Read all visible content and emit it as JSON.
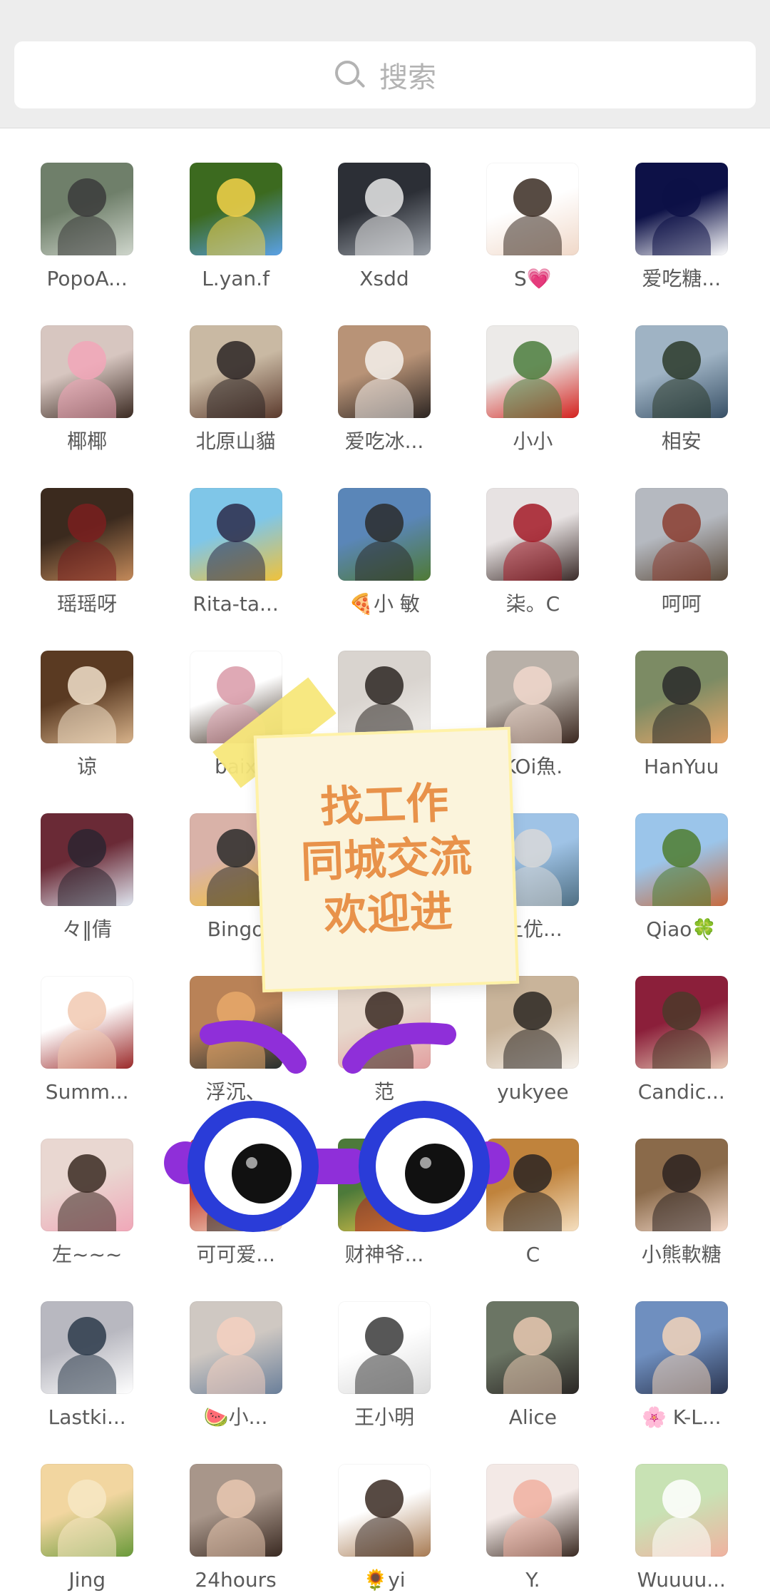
{
  "search": {
    "placeholder": "搜索"
  },
  "members": [
    {
      "name": "PopoA...",
      "colors": [
        "#6f7f6a",
        "#cfd6cc",
        "#3b3b3b"
      ]
    },
    {
      "name": "L.yan.f",
      "colors": [
        "#3c6a1f",
        "#5aa1e6",
        "#f4d24a"
      ]
    },
    {
      "name": "Xsdd",
      "colors": [
        "#2c2f36",
        "#9aa0a8",
        "#e8e8e8"
      ]
    },
    {
      "name": "S💗",
      "colors": [
        "#ffffff",
        "#f0d8c8",
        "#3a2b22"
      ]
    },
    {
      "name": "爱吃糖...",
      "colors": [
        "#0d1147",
        "#ffffff",
        "#0d1147"
      ]
    },
    {
      "name": "椰椰",
      "colors": [
        "#d7c6c0",
        "#3b2a22",
        "#f2a6b8"
      ]
    },
    {
      "name": "北原山貓",
      "colors": [
        "#c9b9a3",
        "#5b3a2d",
        "#2c2424"
      ]
    },
    {
      "name": "爱吃冰...",
      "colors": [
        "#b89377",
        "#2c2522",
        "#f5f1ec"
      ]
    },
    {
      "name": "小小",
      "colors": [
        "#eceae8",
        "#d4221e",
        "#4b7d3c"
      ]
    },
    {
      "name": "相安",
      "colors": [
        "#9fb3c4",
        "#385066",
        "#2c3a2a"
      ]
    },
    {
      "name": "瑶瑶呀",
      "colors": [
        "#3b2a1e",
        "#c48a5a",
        "#7a1f1f"
      ]
    },
    {
      "name": "Rita-ta...",
      "colors": [
        "#7fc6e8",
        "#f0c23a",
        "#2c2a4a"
      ]
    },
    {
      "name": "🍕小 敏",
      "colors": [
        "#5a86b8",
        "#4f7a35",
        "#2b2b2b"
      ]
    },
    {
      "name": "柒。C",
      "colors": [
        "#e7e2e2",
        "#3a2a28",
        "#a31a27"
      ]
    },
    {
      "name": "呵呵",
      "colors": [
        "#b5b9c0",
        "#5b4a3a",
        "#8b3d30"
      ]
    },
    {
      "name": "谅",
      "colors": [
        "#5a3a22",
        "#d7b28a",
        "#f2e2cb"
      ]
    },
    {
      "name": "baix",
      "colors": [
        "#ffffff",
        "#3a2a1e",
        "#d99aa8"
      ]
    },
    {
      "name": "",
      "colors": [
        "#d9d4cf",
        "#f3f1ee",
        "#2b2622"
      ]
    },
    {
      "name": "KOi魚.",
      "colors": [
        "#b8b0a8",
        "#3b2820",
        "#f1d8cc"
      ]
    },
    {
      "name": "HanYuu",
      "colors": [
        "#7c8b64",
        "#e8a86a",
        "#2a2a2a"
      ]
    },
    {
      "name": "々‖倩",
      "colors": [
        "#6a2a36",
        "#e0e6f0",
        "#2b2430"
      ]
    },
    {
      "name": "Bingo",
      "colors": [
        "#d9b2a8",
        "#f3c233",
        "#2a2a2a"
      ]
    },
    {
      "name": "",
      "colors": [
        "#ffffff",
        "#ffffff",
        "#ffffff"
      ]
    },
    {
      "name": "上优...",
      "colors": [
        "#9fc3e6",
        "#4f6f83",
        "#d8d8d8"
      ]
    },
    {
      "name": "Qiao🍀",
      "colors": [
        "#9bc5ea",
        "#c76a3e",
        "#4f7d2f"
      ]
    },
    {
      "name": "Summ...",
      "colors": [
        "#ffffff",
        "#9b2a2a",
        "#f1c9b1"
      ]
    },
    {
      "name": "浮沉、",
      "colors": [
        "#b98257",
        "#28302e",
        "#e7a96a"
      ]
    },
    {
      "name": "范",
      "colors": [
        "#e7d8cc",
        "#e2a0a0",
        "#3a2a22"
      ]
    },
    {
      "name": "yukyee",
      "colors": [
        "#c9b49a",
        "#f5f0ea",
        "#2c2722"
      ]
    },
    {
      "name": "Candic...",
      "colors": [
        "#8b1f3a",
        "#e7c8b4",
        "#4b3a2a"
      ]
    },
    {
      "name": "左~~~",
      "colors": [
        "#e9d7d1",
        "#f0a7b8",
        "#3a2a22"
      ]
    },
    {
      "name": "可可爱...",
      "colors": [
        "#c84a3a",
        "#f3e3d0",
        "#2a2a2a"
      ]
    },
    {
      "name": "财神爷...",
      "colors": [
        "#4d7a3a",
        "#e8c74a",
        "#b32020"
      ]
    },
    {
      "name": "C",
      "colors": [
        "#c0833c",
        "#f5dfc0",
        "#2a2522"
      ]
    },
    {
      "name": "小熊軟糖",
      "colors": [
        "#8a6a4a",
        "#f4d9c9",
        "#2b2220"
      ]
    },
    {
      "name": "Lastki...",
      "colors": [
        "#b8b8c0",
        "#ffffff",
        "#2b3a4a"
      ]
    },
    {
      "name": "🍉小...",
      "colors": [
        "#cfc8c2",
        "#6a7f9a",
        "#f4d0c0"
      ]
    },
    {
      "name": "王小明",
      "colors": [
        "#ffffff",
        "#dadada",
        "#3a3a3a"
      ]
    },
    {
      "name": "Alice",
      "colors": [
        "#6b7564",
        "#2a2624",
        "#e8c8b0"
      ]
    },
    {
      "name": "🌸 K-L...",
      "colors": [
        "#6f8fbf",
        "#2b3550",
        "#f3d4b8"
      ]
    },
    {
      "name": "Jing",
      "colors": [
        "#f2d6a0",
        "#6a9a3a",
        "#f7e8c4"
      ]
    },
    {
      "name": "24hours",
      "colors": [
        "#a8968a",
        "#3a2a22",
        "#e9c8b0"
      ]
    },
    {
      "name": "🌻yi",
      "colors": [
        "#ffffff",
        "#a77a52",
        "#3a2a22"
      ]
    },
    {
      "name": "Y.",
      "colors": [
        "#f3e9e6",
        "#3a2a22",
        "#f0b0a0"
      ]
    },
    {
      "name": "Wuuuu...",
      "colors": [
        "#c8e2b4",
        "#f0b2a0",
        "#ffffff"
      ]
    }
  ],
  "note": {
    "line1": "找工作",
    "line2": "同城交流",
    "line3": "欢迎进",
    "text_color": "#e8924a",
    "paper_color": "#fbf4dc",
    "tape_color": "#f7e77a"
  },
  "eyes_colors": {
    "iris": "#2a3cd8",
    "tube": "#8f2fd9",
    "pupil": "#111111"
  }
}
